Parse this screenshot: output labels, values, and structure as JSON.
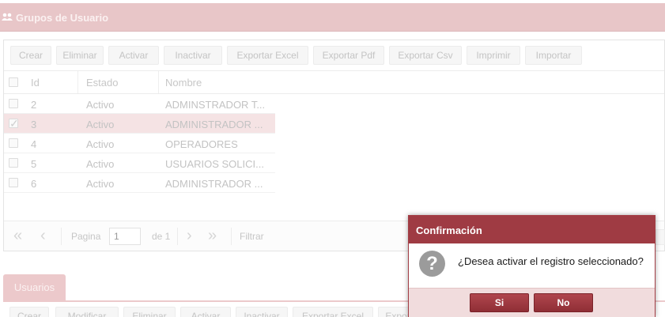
{
  "header": {
    "title": "Grupos de Usuario",
    "icon": "users-icon"
  },
  "toolbar": {
    "buttons": [
      "Crear",
      "Eliminar",
      "Activar",
      "Inactivar",
      "Exportar Excel",
      "Exportar Pdf",
      "Exportar Csv",
      "Imprimir",
      "Importar"
    ]
  },
  "table": {
    "columns": [
      "Id",
      "Estado",
      "Nombre"
    ],
    "rows": [
      {
        "id": "2",
        "estado": "Activo",
        "nombre": "ADMINSTRADOR T...",
        "checked": false
      },
      {
        "id": "3",
        "estado": "Activo",
        "nombre": "ADMINISTRADOR ...",
        "checked": true
      },
      {
        "id": "4",
        "estado": "Activo",
        "nombre": "OPERADORES",
        "checked": false
      },
      {
        "id": "5",
        "estado": "Activo",
        "nombre": "USUARIOS SOLICI...",
        "checked": false
      },
      {
        "id": "6",
        "estado": "Activo",
        "nombre": "ADMINISTRADOR ...",
        "checked": false
      }
    ]
  },
  "pager": {
    "page_label": "Pagina",
    "page_value": "1",
    "of_label": "de 1",
    "filter_label": "Filtrar"
  },
  "tabs": {
    "usuarios": "Usuarios"
  },
  "bottom_toolbar": {
    "buttons": [
      "Crear",
      "Modificar",
      "Eliminar",
      "Activar",
      "Inactivar",
      "Exportar Excel",
      "Expor"
    ]
  },
  "dialog": {
    "title": "Confirmación",
    "message": "¿Desea activar el registro seleccionado?",
    "yes_label": "Si",
    "no_label": "No"
  },
  "colors": {
    "accent": "#9f3b43",
    "header_bg": "#e8c6c8",
    "selected_row": "#f5e3e4"
  }
}
